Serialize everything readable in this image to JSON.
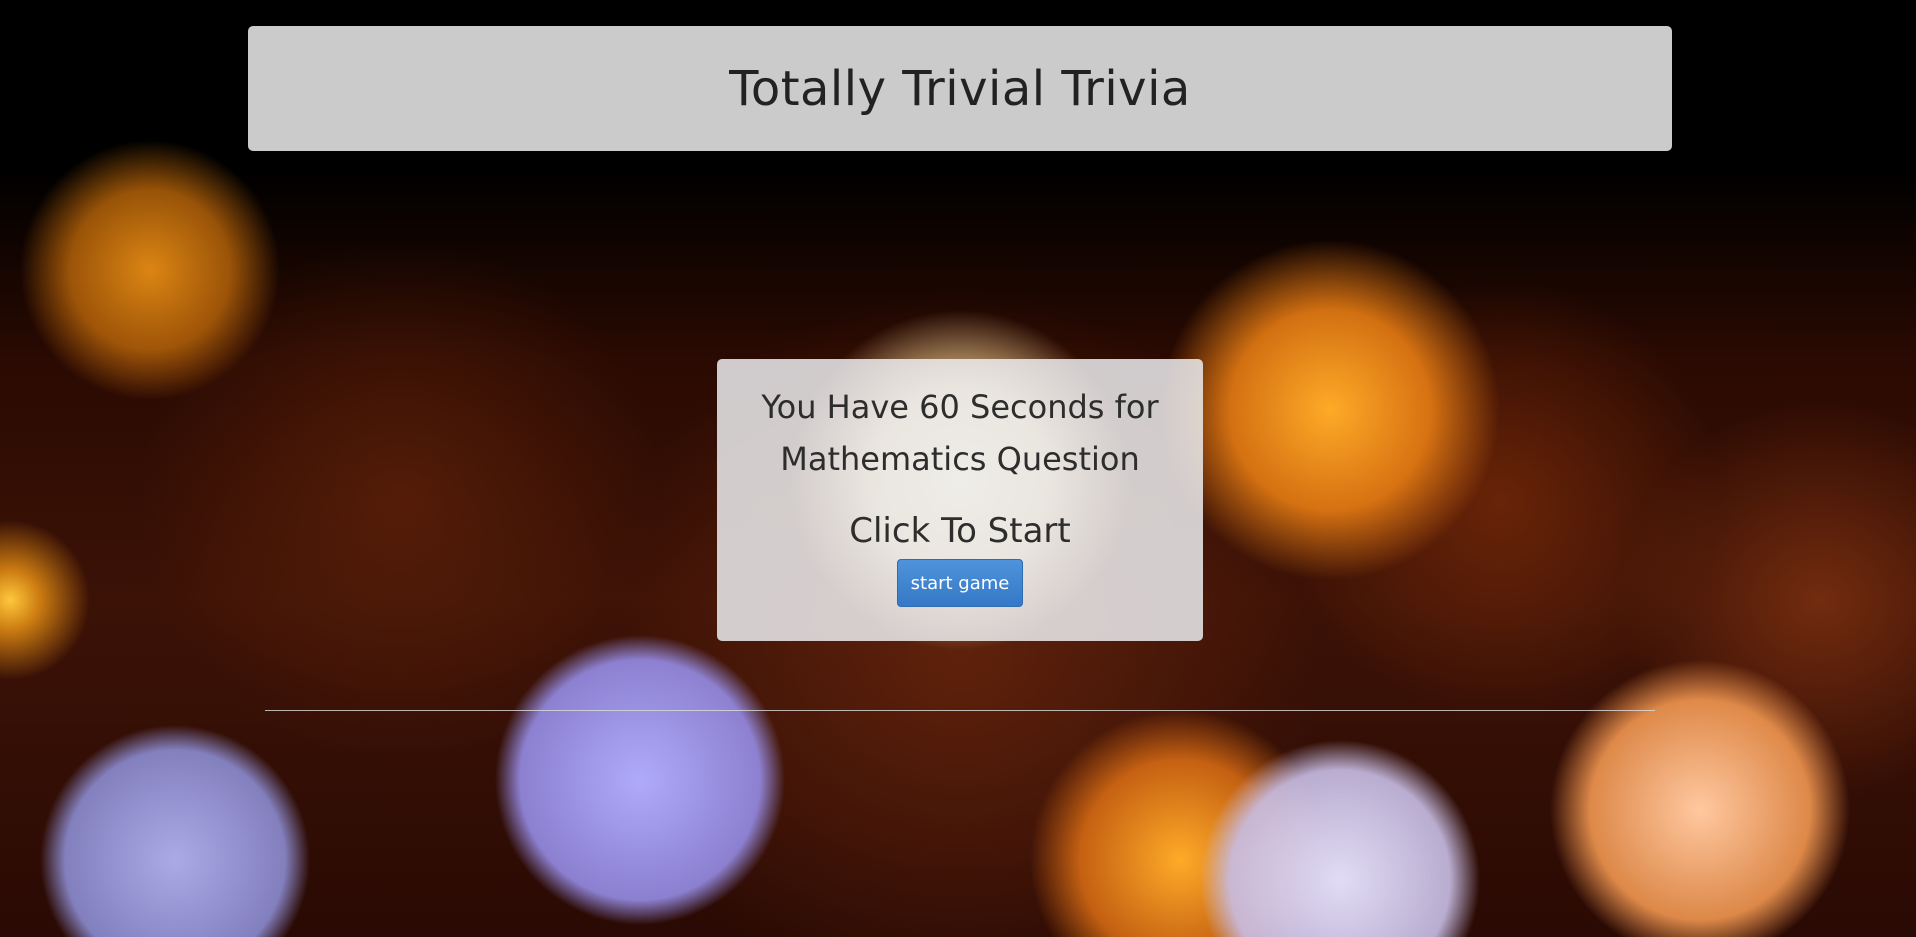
{
  "header": {
    "title": "Totally Trivial Trivia"
  },
  "start_card": {
    "intro": "You Have 60 Seconds for Mathematics Question",
    "cta": "Click To Start",
    "start_button_label": "start game"
  },
  "colors": {
    "header_bg": "#cbcbcb",
    "button": "#3f87d3",
    "card_bg": "#ebebee"
  }
}
